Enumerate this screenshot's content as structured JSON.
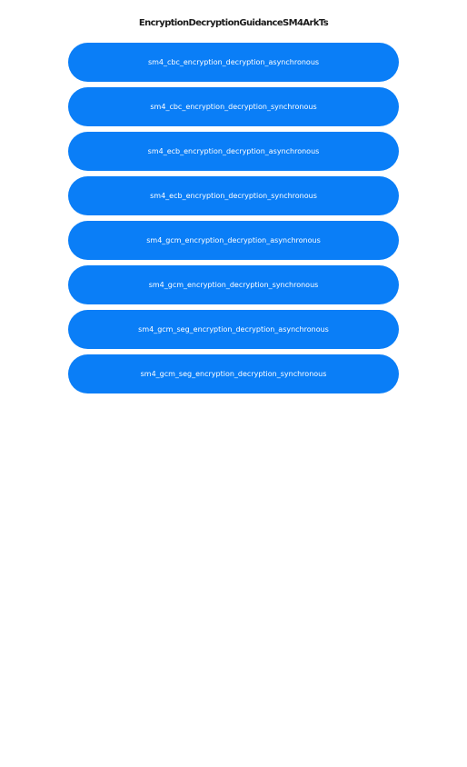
{
  "header": {
    "title": "EncryptionDecryptionGuidanceSM4ArkTs"
  },
  "buttons": [
    {
      "label": "sm4_cbc_encryption_decryption_asynchronous"
    },
    {
      "label": "sm4_cbc_encryption_decryption_synchronous"
    },
    {
      "label": "sm4_ecb_encryption_decryption_asynchronous"
    },
    {
      "label": "sm4_ecb_encryption_decryption_synchronous"
    },
    {
      "label": "sm4_gcm_encryption_decryption_asynchronous"
    },
    {
      "label": "sm4_gcm_encryption_decryption_synchronous"
    },
    {
      "label": "sm4_gcm_seg_encryption_decryption_asynchronous"
    },
    {
      "label": "sm4_gcm_seg_encryption_decryption_synchronous"
    }
  ],
  "theme": {
    "button_color": "#0a7ef7",
    "button_text_color": "#ffffff",
    "title_color": "#1a1a1a",
    "background": "#ffffff"
  }
}
